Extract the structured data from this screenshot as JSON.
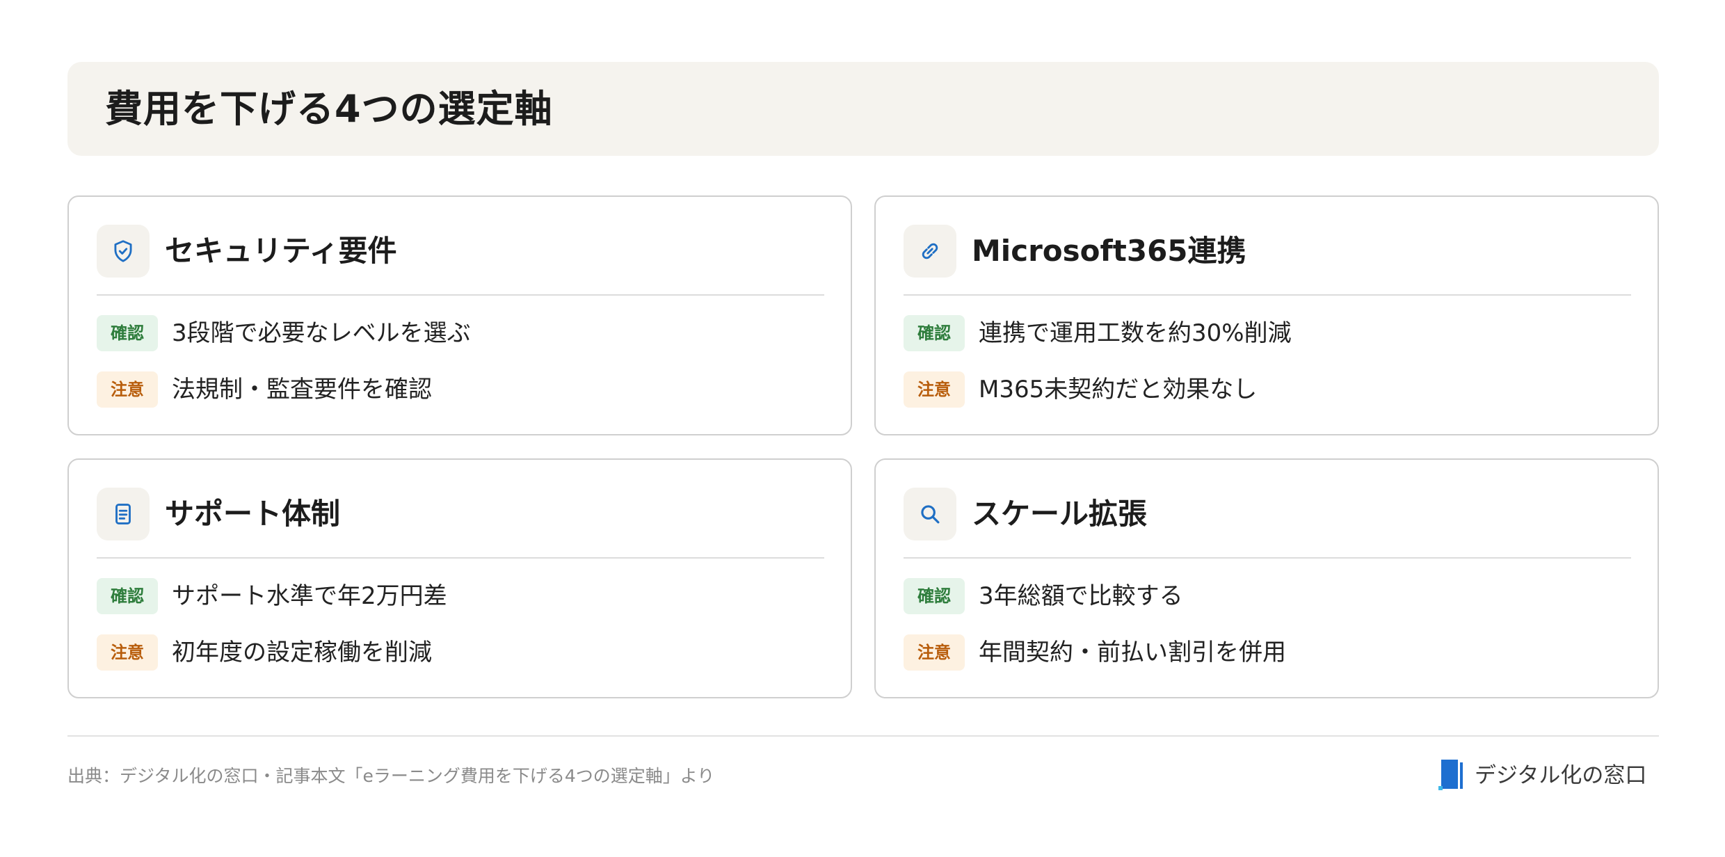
{
  "page": {
    "title": "費用を下げる4つの選定軸"
  },
  "cards": [
    {
      "title": "セキュリティ要件",
      "icon": "shield-check-icon",
      "confirm_label": "確認",
      "confirm_text": "3段階で必要なレベルを選ぶ",
      "caution_label": "注意",
      "caution_text": "法規制・監査要件を確認"
    },
    {
      "title": "Microsoft365連携",
      "icon": "link-icon",
      "confirm_label": "確認",
      "confirm_text": "連携で運用工数を約30%削減",
      "caution_label": "注意",
      "caution_text": "M365未契約だと効果なし"
    },
    {
      "title": "サポート体制",
      "icon": "document-icon",
      "confirm_label": "確認",
      "confirm_text": "サポート水準で年2万円差",
      "caution_label": "注意",
      "caution_text": "初年度の設定稼働を削減"
    },
    {
      "title": "スケール拡張",
      "icon": "search-icon",
      "confirm_label": "確認",
      "confirm_text": "3年総額で比較する",
      "caution_label": "注意",
      "caution_text": "年間契約・前払い割引を併用"
    }
  ],
  "footer": {
    "source": "出典：デジタル化の窓口・記事本文「eラーニング費用を下げる4つの選定軸」より",
    "logo_text": "デジタル化の窓口"
  },
  "colors": {
    "icon_blue": "#1f6fc4",
    "confirm_bg": "#e6f4ea",
    "confirm_fg": "#2e7d3c",
    "caution_bg": "#fdf1e1",
    "caution_fg": "#b85d0b",
    "banner_bg": "#f5f3ee",
    "logo_blue": "#1e6fd0",
    "logo_cyan": "#3fb8e8"
  }
}
